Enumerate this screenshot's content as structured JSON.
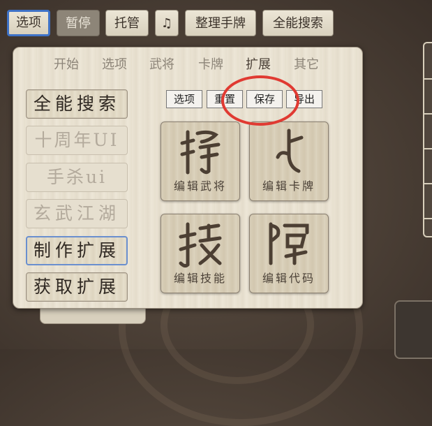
{
  "topbar": {
    "buttons": [
      "选项",
      "暂停",
      "托管",
      "♫",
      "整理手牌",
      "全能搜索"
    ]
  },
  "tabs": [
    "开始",
    "选项",
    "武将",
    "卡牌",
    "扩展",
    "其它"
  ],
  "sidebar": [
    "全能搜索",
    "十周年UI",
    "手杀ui",
    "玄武江湖",
    "制作扩展",
    "获取扩展"
  ],
  "toolbar": [
    "选项",
    "重置",
    "保存",
    "导出"
  ],
  "tiles": [
    {
      "caption": "编辑武将",
      "icon": "ancient-script-general-icon"
    },
    {
      "caption": "编辑卡牌",
      "icon": "ancient-script-card-icon"
    },
    {
      "caption": "编辑技能",
      "icon": "ancient-script-skill-icon"
    },
    {
      "caption": "编辑代码",
      "icon": "ancient-script-code-icon"
    }
  ],
  "colors": {
    "accent": "#3e72c7",
    "highlight_ring": "#e03a32"
  }
}
